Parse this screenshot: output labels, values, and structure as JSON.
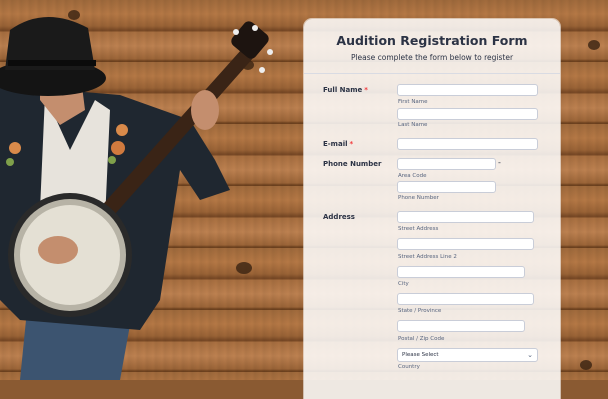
{
  "form": {
    "title": "Audition Registration Form",
    "subtitle": "Please complete the form below to register"
  },
  "fields": {
    "full_name": {
      "label": "Full Name",
      "required": "*",
      "first_sub": "First Name",
      "last_sub": "Last Name"
    },
    "email": {
      "label": "E-mail",
      "required": "*"
    },
    "phone": {
      "label": "Phone Number",
      "dash": "-",
      "area_sub": "Area Code",
      "number_sub": "Phone Number"
    },
    "address": {
      "label": "Address",
      "street_sub": "Street Address",
      "street2_sub": "Street Address Line 2",
      "city_sub": "City",
      "state_sub": "State / Province",
      "postal_sub": "Postal / Zip Code",
      "country_selected": "Please Select",
      "country_sub": "Country"
    }
  },
  "colors": {
    "required": "#f23a3c",
    "text": "#2c3345",
    "sublabel": "#57647e"
  },
  "icons": {
    "select_arrow": "chevron-down-icon"
  }
}
